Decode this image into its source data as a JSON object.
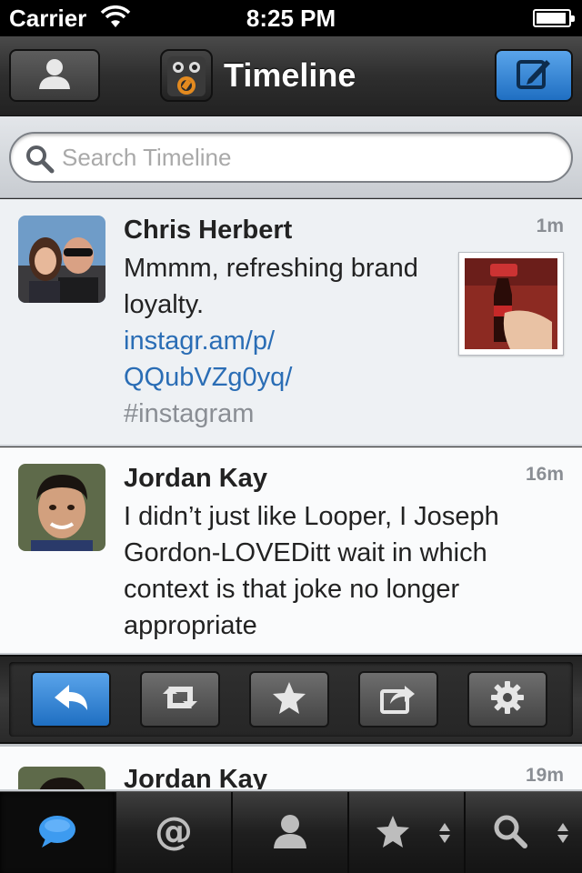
{
  "status_bar": {
    "carrier": "Carrier",
    "time": "8:25 PM",
    "battery_level": 0.9
  },
  "nav": {
    "title": "Timeline"
  },
  "search": {
    "placeholder": "Search Timeline"
  },
  "tweets": [
    {
      "name": "Chris Herbert",
      "time": "1m",
      "text": "Mmmm, refreshing brand loyalty.",
      "link_line1": "instagr.am/p/",
      "link_line2": "QQubVZg0yq/",
      "hashtag": "#instagram"
    },
    {
      "name": "Jordan Kay",
      "time": "16m",
      "text": "I didn’t just like Looper, I Joseph Gordon-LOVEDitt wait in which context is that joke no longer appropriate"
    },
    {
      "name": "Jordan Kay",
      "time": "19m"
    }
  ],
  "actions": [
    "reply-icon",
    "retweet-icon",
    "star-icon",
    "share-icon",
    "gear-icon"
  ],
  "tabs": [
    "timeline-bubble-icon",
    "at-mention-icon",
    "profile-icon",
    "favorites-star-icon",
    "search-icon"
  ],
  "colors": {
    "accent_blue": "#2f86d8",
    "link": "#2a6db5"
  }
}
